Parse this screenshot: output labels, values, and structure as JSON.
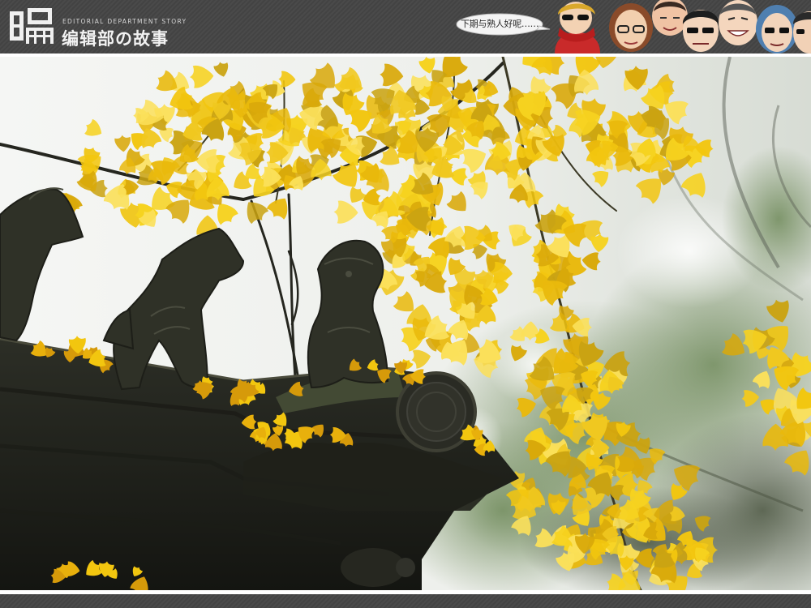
{
  "header": {
    "logo_en": "EDITORIAL DEPARTMENT STORY",
    "logo_cn": "编辑部の故事",
    "speech_text": "下期与熟人好呢……"
  },
  "photo": {
    "subject": "ginkgo-and-roof-guardian-statues"
  },
  "colors": {
    "banner": "#4a4a4a",
    "ginkgo": "#f2c60f",
    "stone": "#2f3127"
  }
}
